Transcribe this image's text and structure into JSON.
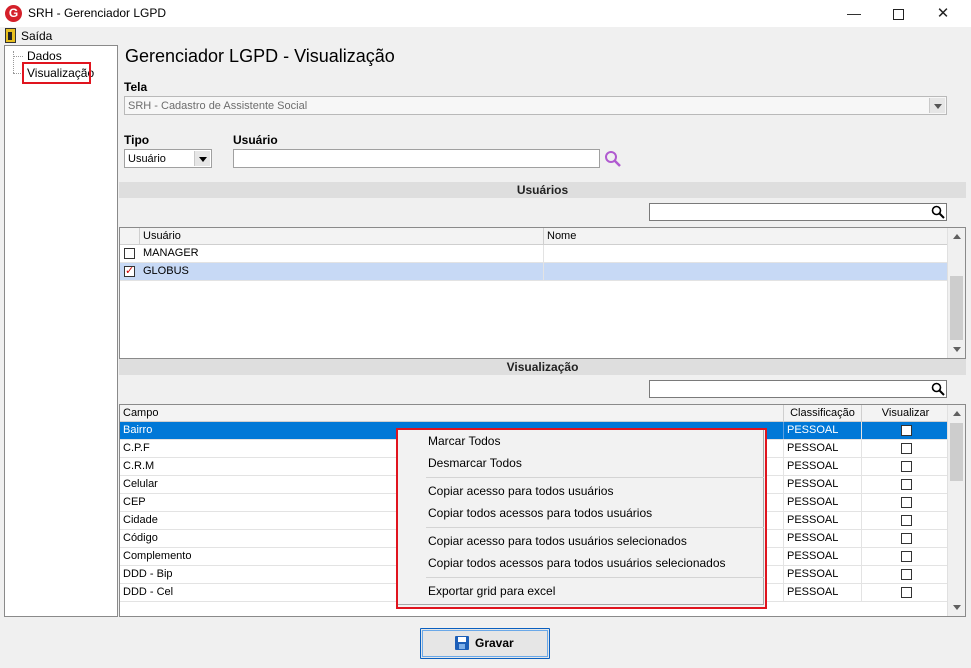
{
  "window": {
    "title": "SRH - Gerenciador LGPD",
    "app_icon": "G",
    "min_glyph": "—",
    "close_glyph": "✕"
  },
  "menu": {
    "exit_label": "Saída"
  },
  "tree": {
    "items": [
      "Dados",
      "Visualização"
    ]
  },
  "main": {
    "title": "Gerenciador LGPD - Visualização",
    "tela_label": "Tela",
    "tela_value": "SRH - Cadastro de Assistente Social",
    "tipo_label": "Tipo",
    "tipo_value": "Usuário",
    "usuario_label": "Usuário",
    "usuario_value": ""
  },
  "usuarios": {
    "header": "Usuários",
    "search_value": "",
    "columns": [
      "Usuário",
      "Nome"
    ],
    "rows": [
      {
        "usuario": "MANAGER",
        "nome": "",
        "checked": false
      },
      {
        "usuario": "GLOBUS",
        "nome": "",
        "checked": true
      }
    ]
  },
  "visualizacao": {
    "header": "Visualização",
    "search_value": "",
    "columns": [
      "Campo",
      "Classificação",
      "Visualizar"
    ],
    "rows": [
      {
        "campo": "Bairro",
        "classificacao": "PESSOAL"
      },
      {
        "campo": "C.P.F",
        "classificacao": "PESSOAL"
      },
      {
        "campo": "C.R.M",
        "classificacao": "PESSOAL"
      },
      {
        "campo": "Celular",
        "classificacao": "PESSOAL"
      },
      {
        "campo": "CEP",
        "classificacao": "PESSOAL"
      },
      {
        "campo": "Cidade",
        "classificacao": "PESSOAL"
      },
      {
        "campo": "Código",
        "classificacao": "PESSOAL"
      },
      {
        "campo": "Complemento",
        "classificacao": "PESSOAL"
      },
      {
        "campo": "DDD - Bip",
        "classificacao": "PESSOAL"
      },
      {
        "campo": "DDD - Cel",
        "classificacao": "PESSOAL"
      }
    ]
  },
  "context_menu": {
    "items": [
      "Marcar Todos",
      "Desmarcar Todos",
      "Copiar acesso para todos usuários",
      "Copiar todos acessos para todos usuários",
      "Copiar acesso para todos usuários selecionados",
      "Copiar todos acessos para todos usuários selecionados",
      "Exportar grid para excel"
    ]
  },
  "footer": {
    "save_label": "Gravar"
  },
  "colors": {
    "selection": "#0078d7",
    "highlight": "#e0141e",
    "selected_row": "#c7d9f5"
  }
}
